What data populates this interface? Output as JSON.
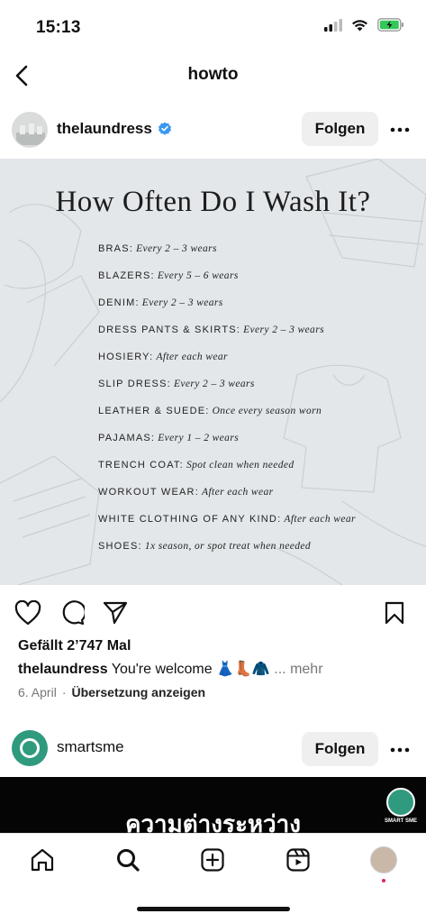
{
  "status": {
    "time": "15:13"
  },
  "nav": {
    "title": "howto"
  },
  "post": {
    "username": "thelaundress",
    "verified": true,
    "follow_label": "Folgen",
    "image": {
      "title": "How Often Do I Wash It?",
      "items": [
        {
          "category": "BRAS:",
          "frequency": "Every 2 – 3 wears"
        },
        {
          "category": "BLAZERS:",
          "frequency": "Every 5 – 6 wears"
        },
        {
          "category": "DENIM:",
          "frequency": "Every 2 – 3 wears"
        },
        {
          "category": "DRESS PANTS & SKIRTS:",
          "frequency": "Every 2 – 3 wears"
        },
        {
          "category": "HOSIERY:",
          "frequency": "After each wear"
        },
        {
          "category": "SLIP DRESS:",
          "frequency": "Every 2 – 3 wears"
        },
        {
          "category": "LEATHER & SUEDE:",
          "frequency": "Once every season worn"
        },
        {
          "category": "PAJAMAS:",
          "frequency": "Every 1 – 2 wears"
        },
        {
          "category": "TRENCH COAT:",
          "frequency": "Spot clean when needed"
        },
        {
          "category": "WORKOUT WEAR:",
          "frequency": "After each wear"
        },
        {
          "category": "WHITE CLOTHING OF ANY KIND:",
          "frequency": "After each wear"
        },
        {
          "category": "SHOES:",
          "frequency": "1x season, or spot treat when needed"
        }
      ]
    },
    "likes": "Gefällt 2’747 Mal",
    "caption_user": "thelaundress",
    "caption_text": "You're welcome 👗👢🧥",
    "caption_more": "... mehr",
    "date": "6. April",
    "separator": "·",
    "translate_label": "Übersetzung anzeigen"
  },
  "next_post": {
    "username": "smartsme",
    "follow_label": "Folgen",
    "image_text": "ความต่างระหว่าง",
    "logo_text": "SMART SME"
  },
  "icons": {
    "back": "chevron-left-icon",
    "verified": "verified-badge-icon",
    "more": "more-horizontal-icon",
    "like": "heart-icon",
    "comment": "comment-icon",
    "share": "send-icon",
    "save": "bookmark-icon",
    "home": "home-icon",
    "search": "search-icon",
    "create": "plus-square-icon",
    "reels": "reels-icon",
    "profile": "profile-avatar"
  },
  "colors": {
    "verified": "#3897f0",
    "image_bg": "#e3e7ea",
    "follow_bg": "#efefef",
    "notification_dot": "#e0245e",
    "battery": "#34c759"
  }
}
